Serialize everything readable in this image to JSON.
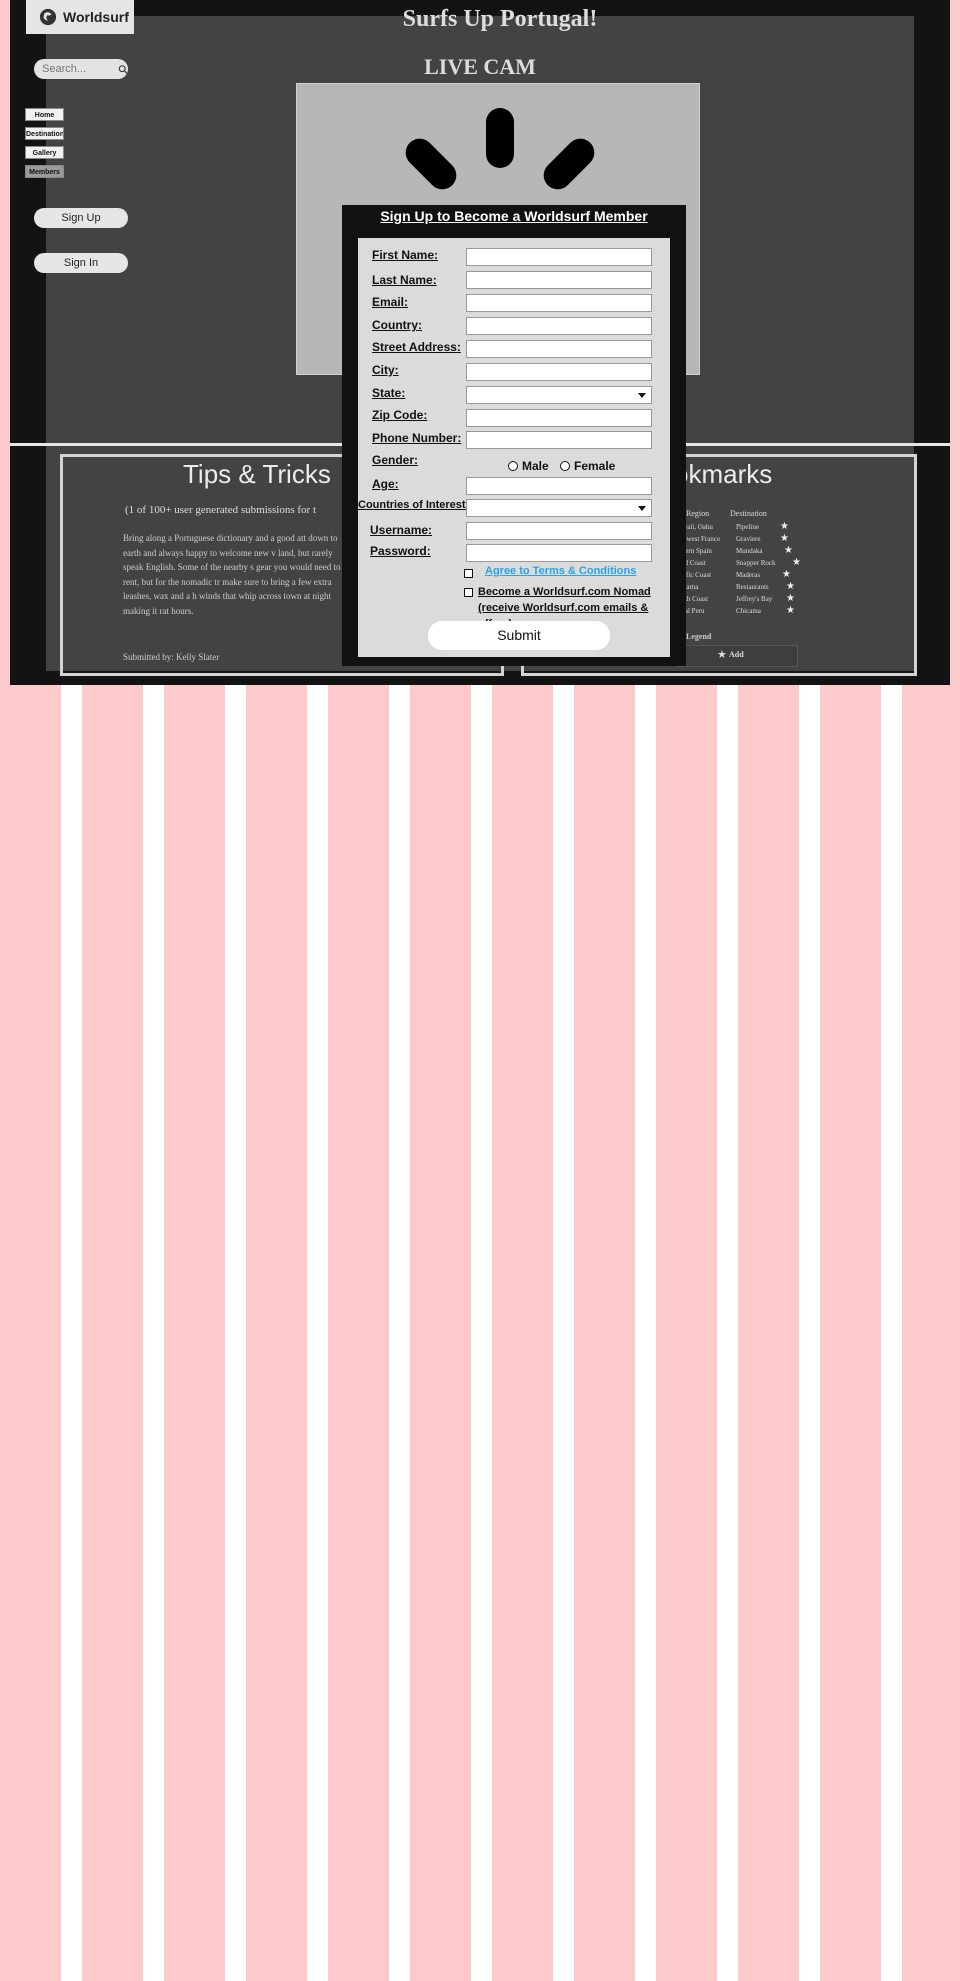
{
  "brand": {
    "name": "Worldsurf"
  },
  "search": {
    "placeholder": "Search..."
  },
  "nav": [
    {
      "label": "Home"
    },
    {
      "label": "Destinations"
    },
    {
      "label": "Gallery"
    },
    {
      "label": "Members"
    }
  ],
  "auth": {
    "signup_label": "Sign Up",
    "signin_label": "Sign In"
  },
  "page": {
    "title": "Surfs Up Portugal!",
    "live_cam": "LIVE CAM"
  },
  "tips": {
    "title": "Tips & Tricks",
    "subtitle": "(1 of 100+ user generated submissions for t",
    "body": "Bring along a Portuguese dictionary and a good att down to earth and always happy to welcome new v land, but rarely speak English. Some of the nearby s gear you would need to rent, but for the nomadic tr make sure to bring a few extra leashes, wax and a h winds that whip across town at night making it rat hours.",
    "submitted_by": "Submitted by: Kelly Slater"
  },
  "bookmarks": {
    "title": "okmarks",
    "region_header": "Region",
    "destination_header": "Destination",
    "rows": [
      {
        "region": "Hawaii, Oahu",
        "destination": "Pipeline"
      },
      {
        "region": "outhwest France",
        "destination": "Graviere"
      },
      {
        "region": "orthern Spain",
        "destination": "Mundaka"
      },
      {
        "region": "Gold Coast",
        "destination": "Snapper Rock"
      },
      {
        "region": "Pacific Coast",
        "destination": "Maderas"
      },
      {
        "region": "Tamarna",
        "destination": "Restaurants"
      },
      {
        "region": "South Coast",
        "destination": "Jeffrey's Bay"
      },
      {
        "region": "entral Peru",
        "destination": "Chicama"
      }
    ],
    "legend_label": "Legend",
    "add_label": "Add"
  },
  "signup_form": {
    "title": "Sign Up to Become a Worldsurf Member",
    "labels": {
      "first_name": "First Name:",
      "last_name": "Last Name:",
      "email": "Email:",
      "country": "Country:",
      "street": "Street Address:",
      "city": "City:",
      "state": "State:",
      "zip": "Zip Code:",
      "phone": "Phone Number:",
      "gender": "Gender:",
      "age": "Age:",
      "countries": "Countries of Interest:",
      "username": "Username:",
      "password": "Password:"
    },
    "gender_options": {
      "male": "Male",
      "female": "Female"
    },
    "terms_label": "Agree to Terms & Conditions",
    "nomad_line1": "Become a Worldsurf.com Nomad",
    "nomad_line2": "(receive Worldsurf.com emails & offers)",
    "submit_label": "Submit"
  }
}
